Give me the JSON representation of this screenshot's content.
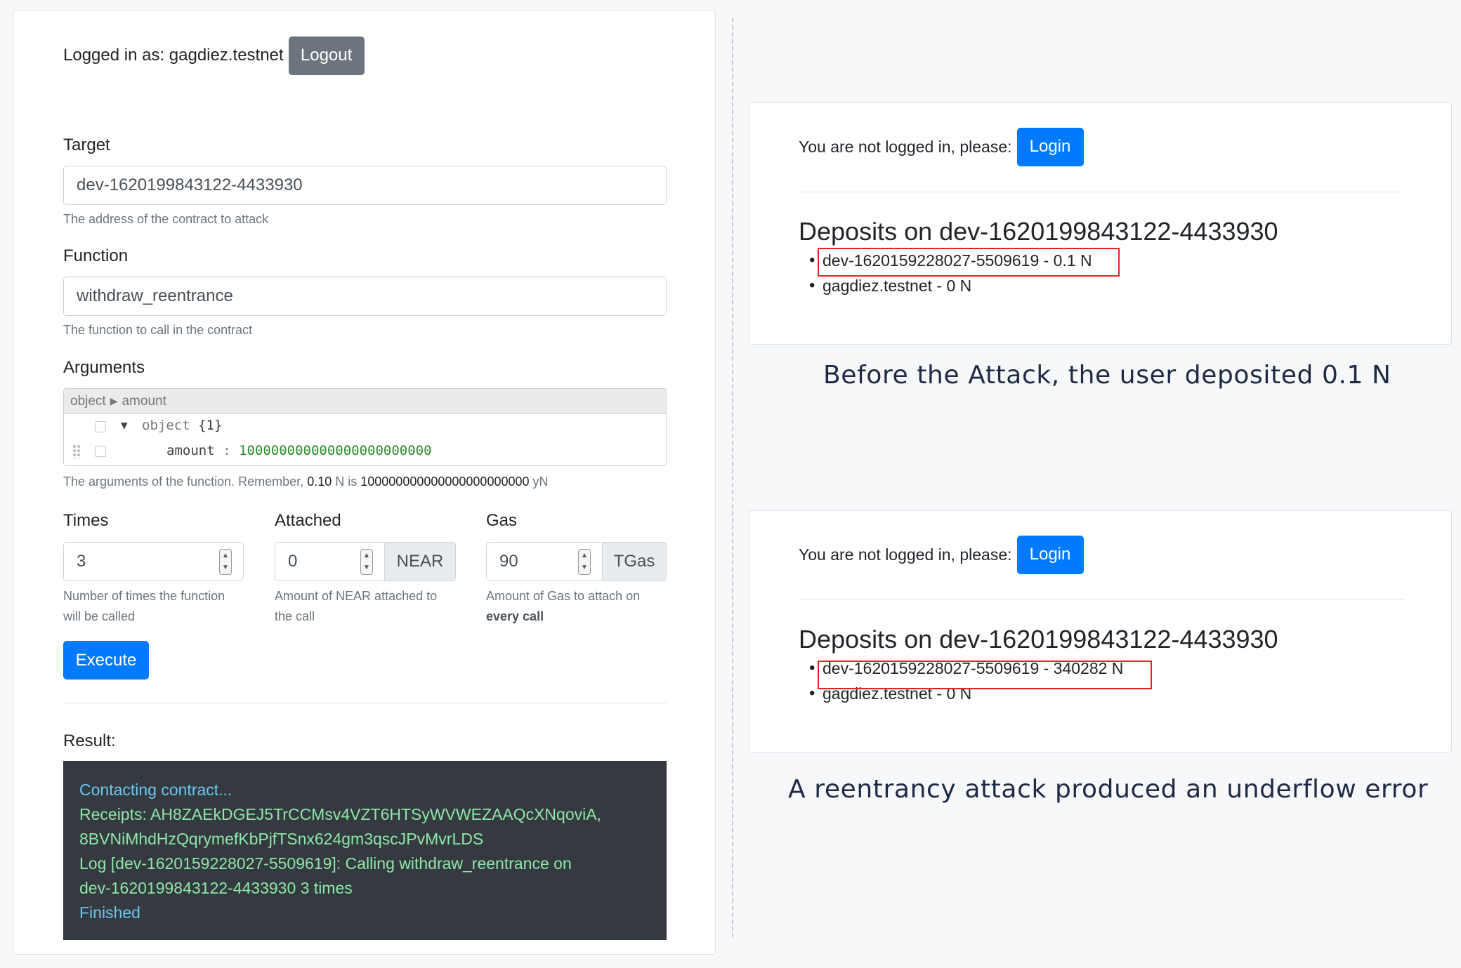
{
  "left": {
    "login_text": "Logged in as: gagdiez.testnet",
    "logout_label": "Logout",
    "target": {
      "label": "Target",
      "value": "dev-1620199843122-4433930",
      "help": "The address of the contract to attack"
    },
    "function": {
      "label": "Function",
      "value": "withdraw_reentrance",
      "help": "The function to call in the contract"
    },
    "arguments": {
      "label": "Arguments",
      "breadcrumb_root": "object",
      "breadcrumb_leaf": "amount",
      "object_key": "object",
      "object_count": "{1}",
      "amount_key": "amount",
      "amount_value": "100000000000000000000000",
      "help_prefix": "The arguments of the function. Remember, ",
      "help_near": "0.10",
      "help_mid": " N is ",
      "help_yocto": "100000000000000000000000",
      "help_suffix": " yN"
    },
    "times": {
      "label": "Times",
      "value": "3",
      "help_line1": "Number of times the function",
      "help_line2": "will be called"
    },
    "attached": {
      "label": "Attached",
      "value": "0",
      "unit": "NEAR",
      "help_line1": "Amount of NEAR attached to",
      "help_line2": "the call"
    },
    "gas": {
      "label": "Gas",
      "value": "90",
      "unit": "TGas",
      "help_line1": "Amount of Gas to attach on",
      "help_line2": "every call"
    },
    "execute_label": "Execute",
    "result_label": "Result:",
    "result_lines": [
      "Contacting contract...",
      "Receipts: AH8ZAEkDGEJ5TrCCMsv4VZT6HTSyWVWEZAAQcXNqoviA,",
      "8BVNiMhdHzQqrymefKbPjfTSnx624gm3qscJPvMvrLDS",
      "Log [dev-1620159228027-5509619]: Calling withdraw_reentrance on",
      "dev-1620199843122-4433930 3 times",
      "Finished"
    ]
  },
  "before": {
    "login_text": "You are not logged in, please:",
    "login_label": "Login",
    "title": "Deposits on dev-1620199843122-4433930",
    "deposits": [
      "dev-1620159228027-5509619 - 0.1 N",
      "gagdiez.testnet - 0 N"
    ],
    "caption": "Before the Attack, the user deposited 0.1 N"
  },
  "after": {
    "login_text": "You are not logged in, please:",
    "login_label": "Login",
    "title": "Deposits on dev-1620199843122-4433930",
    "deposits": [
      "dev-1620159228027-5509619 - 340282 N",
      "gagdiez.testnet - 0 N"
    ],
    "caption": "A reentrancy attack produced an underflow error"
  },
  "colors": {
    "primary": "#007bff",
    "secondary": "#6c757d",
    "highlight": "#e02424",
    "terminal_bg": "#343a40",
    "terminal_text": "#8ee6a8"
  }
}
